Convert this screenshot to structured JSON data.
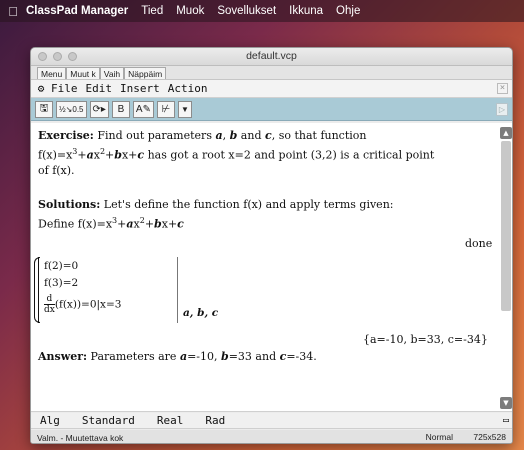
{
  "mac_menu": {
    "apple_icon": "apple-icon",
    "app_name": "ClassPad Manager",
    "items": [
      "Tied",
      "Muok",
      "Sovellukset",
      "Ikkuna",
      "Ohje"
    ]
  },
  "window": {
    "title": "default.vcp",
    "keyboard_tabs": [
      "Menu",
      "Muut k",
      "Vaih",
      "Näppäim"
    ],
    "menu": {
      "gear_icon": "gear-icon",
      "items": [
        "File",
        "Edit",
        "Insert",
        "Action"
      ],
      "close_glyph": "×"
    },
    "toolbar": {
      "buttons": [
        {
          "name": "save-icon",
          "label": "🖫"
        },
        {
          "name": "fraction-decimal-icon",
          "label": "½↘0.5"
        },
        {
          "name": "run-icon",
          "label": "⟳▸"
        },
        {
          "name": "bold-button",
          "label": "B"
        },
        {
          "name": "assign-icon",
          "label": "A✎"
        },
        {
          "name": "graph-icon",
          "label": "⊬"
        },
        {
          "name": "dropdown-icon",
          "label": "▼"
        }
      ],
      "right_arrow": "▷"
    }
  },
  "document": {
    "exercise": {
      "label": "Exercise:",
      "text1": " Find out parameters ",
      "a": "a",
      "comma1": ", ",
      "b": "b",
      "and": " and ",
      "c": "c",
      "text2": ", so that function"
    },
    "function_line": {
      "fx": "f(x)=x",
      "exp3": "3",
      "plus_a": "+",
      "a": "a",
      "x": "x",
      "exp2": "2",
      "plus_b": "+",
      "b": "b",
      "xplus": "x+",
      "c": "c",
      "rest": " has got a root x=2 and point (3,2) is a critical point"
    },
    "of_fx": "of f(x).",
    "solutions": {
      "label": "Solutions:",
      "text": " Let's define the function f(x) and apply terms given:"
    },
    "define": {
      "prefix": "Define f(x)=x",
      "exp3": "3",
      "plus": "+",
      "a": "a",
      "x": "x",
      "exp2": "2",
      "plus2": "+",
      "b": "b",
      "xplus": "x+",
      "c": "c"
    },
    "done": "done",
    "system": {
      "eq1": "f(2)=0",
      "eq2": "f(3)=2",
      "deriv_num": "d",
      "deriv_den": "dx",
      "eq3_rest": "(f(x))=0|x=3",
      "vars": "a, b, c"
    },
    "result": "{a=-10, b=33, c=-34}",
    "answer": {
      "label": "Answer:",
      "text1": " Parameters are ",
      "a": "a",
      "a_val": "=-10, ",
      "b": "b",
      "b_val": "=33 and ",
      "c": "c",
      "c_val": "=-34."
    }
  },
  "modebar": {
    "items": [
      "Alg",
      "Standard",
      "Real",
      "Rad"
    ],
    "battery_icon": "battery-icon"
  },
  "statusbar": {
    "left": "Valm. - Muutettava kok",
    "mode": "Normal",
    "size": "725x528"
  },
  "colors": {
    "toolbar": "#a9cad6",
    "desktop_start": "#3a1a3e",
    "desktop_end": "#e6884a"
  }
}
